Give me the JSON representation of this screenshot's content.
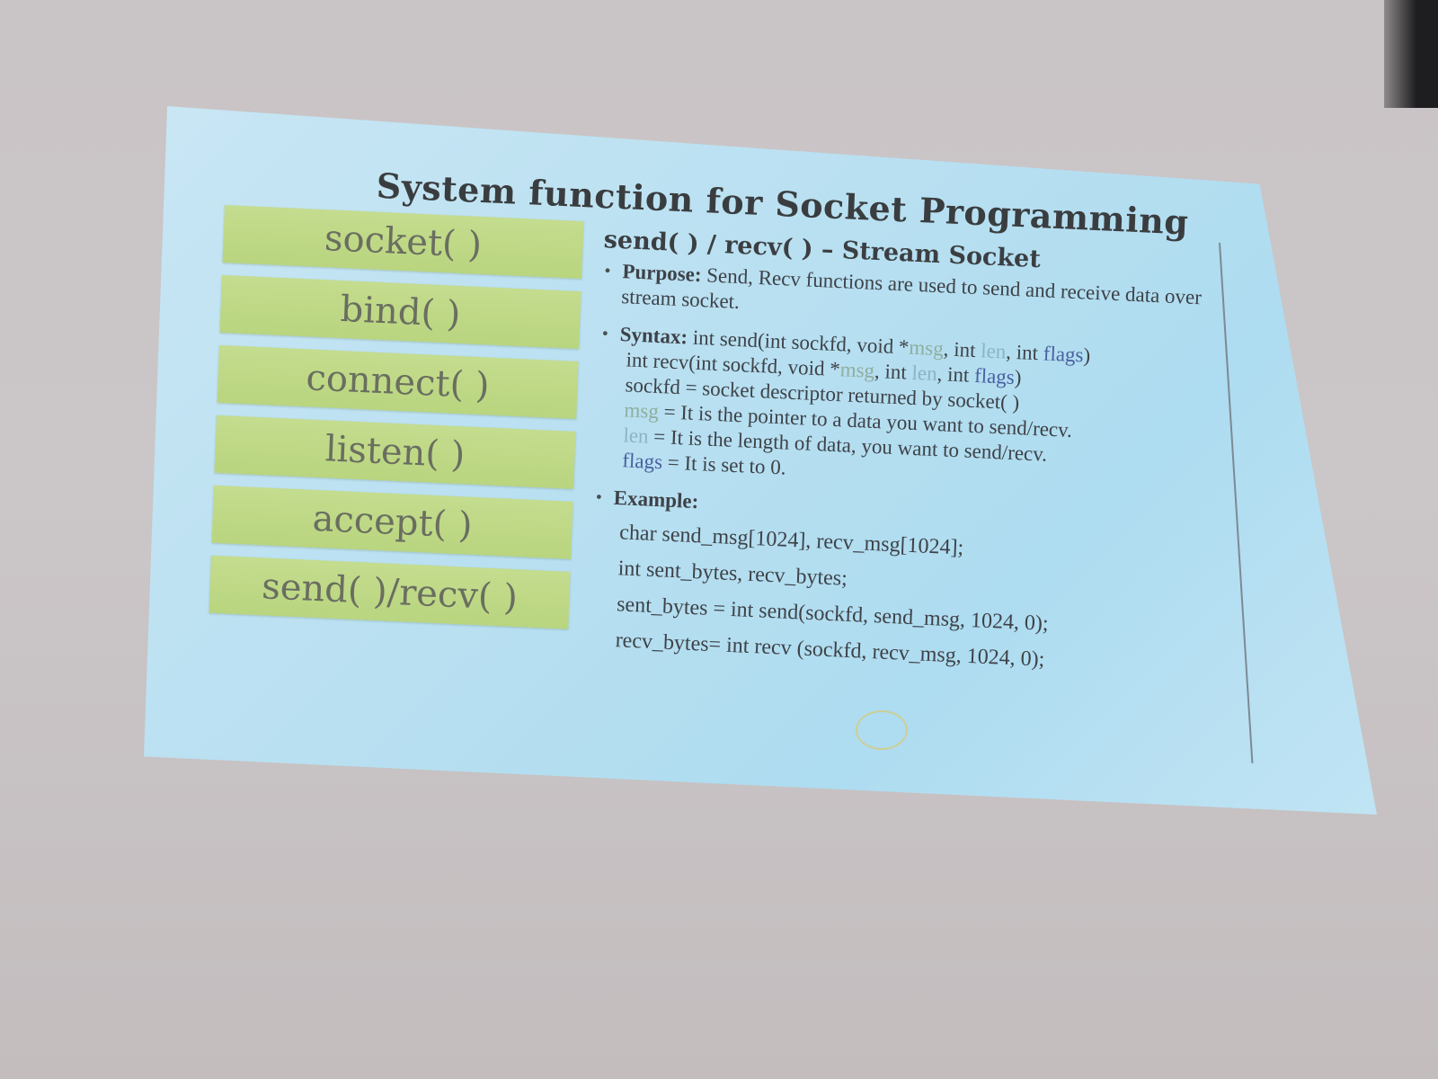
{
  "slide": {
    "title": "System function for Socket Programming",
    "functions": [
      "socket( )",
      "bind( )",
      "connect( )",
      "listen( )",
      "accept( )",
      "send( )/recv( )"
    ],
    "subheading": "send( ) / recv( ) – Stream Socket",
    "purpose": {
      "label": "Purpose:",
      "text": " Send, Recv functions are used to send and receive data over stream socket."
    },
    "syntax": {
      "label": "Syntax:",
      "send_prefix": " int send(int sockfd, void *",
      "recv_prefix": "int recv(int sockfd, void *",
      "msg": "msg",
      "sep_int": ", int ",
      "len": "len",
      "flags": "flags",
      "close": ")",
      "sockfd_def": "sockfd = socket descriptor returned by socket( )",
      "msg_def": " = It is the pointer to a data you want to send/recv.",
      "len_def": " = It is the length of data, you want to send/recv.",
      "flags_def": " = It is set to 0."
    },
    "example": {
      "label": "Example:",
      "lines": [
        "char send_msg[1024], recv_msg[1024];",
        "int sent_bytes, recv_bytes;",
        "sent_bytes = int send(sockfd, send_msg, 1024, 0);",
        "recv_bytes= int recv (sockfd, recv_msg, 1024, 0);"
      ]
    },
    "bullet_glyph": "•"
  }
}
